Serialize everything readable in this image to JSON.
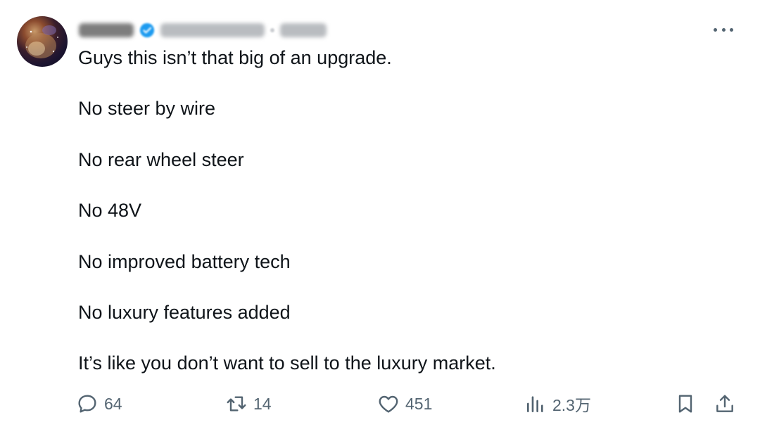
{
  "tweet": {
    "more_label": "More",
    "lines": [
      "Guys this isn’t that big of an upgrade.",
      "No steer by wire",
      "No rear wheel steer",
      "No 48V",
      "No improved battery tech",
      "No luxury features added",
      "It’s like you don’t want to sell to the luxury market."
    ]
  },
  "actions": {
    "replies": "64",
    "retweets": "14",
    "likes": "451",
    "views": "2.3万"
  },
  "colors": {
    "text": "#0f1419",
    "muted": "#536471",
    "verified": "#1d9bf0"
  }
}
